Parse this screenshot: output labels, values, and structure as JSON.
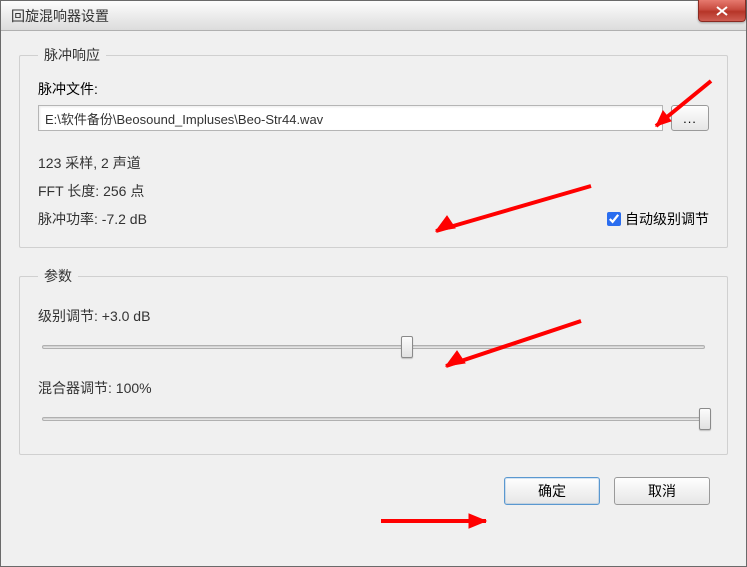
{
  "window": {
    "title": "回旋混响器设置"
  },
  "impulse": {
    "legend": "脉冲响应",
    "file_label": "脉冲文件:",
    "file_value": "E:\\软件备份\\Beosound_Impluses\\Beo-Str44.wav",
    "browse_label": "...",
    "samples_line": "123 采样, 2 声道",
    "fft_line": "FFT 长度: 256 点",
    "power_line": "脉冲功率: -7.2 dB",
    "auto_label": "自动级别调节",
    "auto_checked": true
  },
  "params": {
    "legend": "参数",
    "level_label": "级别调节: +3.0 dB",
    "level_percent": 55,
    "mix_label": "混合器调节: 100%",
    "mix_percent": 100
  },
  "footer": {
    "ok": "确定",
    "cancel": "取消"
  }
}
